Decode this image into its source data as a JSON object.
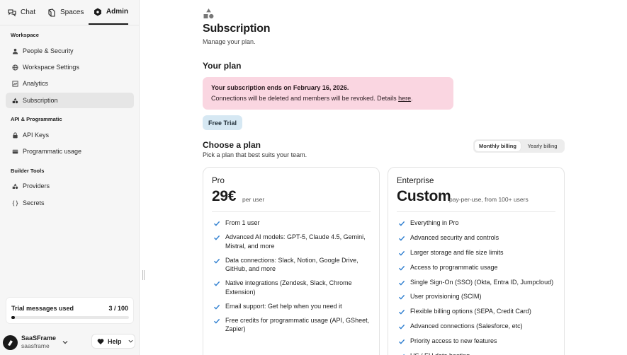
{
  "topnav": {
    "tabs": [
      {
        "label": "Chat",
        "icon": "chat-bubbles-icon"
      },
      {
        "label": "Spaces",
        "icon": "book-icon"
      },
      {
        "label": "Admin",
        "icon": "hexagon-gear-icon"
      }
    ],
    "active": "Admin"
  },
  "sidebar": {
    "sections": [
      {
        "title": "Workspace",
        "items": [
          {
            "label": "People & Security",
            "icon": "person-icon"
          },
          {
            "label": "Workspace Settings",
            "icon": "globe-icon"
          },
          {
            "label": "Analytics",
            "icon": "chart-icon"
          },
          {
            "label": "Subscription",
            "icon": "shapes-icon",
            "active": true
          }
        ]
      },
      {
        "title": "API & Programmatic",
        "items": [
          {
            "label": "API Keys",
            "icon": "lock-icon"
          },
          {
            "label": "Programmatic usage",
            "icon": "card-icon"
          }
        ]
      },
      {
        "title": "Builder Tools",
        "items": [
          {
            "label": "Providers",
            "icon": "shapes-icon"
          },
          {
            "label": "Secrets",
            "icon": "braces-icon"
          }
        ]
      }
    ],
    "trial": {
      "label": "Trial messages used",
      "count": "3 / 100",
      "used": 3,
      "total": 100
    },
    "account": {
      "name": "SaaSFrame",
      "sub": "saasframe"
    },
    "help_label": "Help"
  },
  "main": {
    "title": "Subscription",
    "subtitle": "Manage your plan.",
    "your_plan_heading": "Your plan",
    "alert": {
      "title": "Your subscription ends on February 16, 2026.",
      "body": "Connections will be deleted and members will be revoked. Details ",
      "link": "here",
      "period": "."
    },
    "current_plan_badge": "Free Trial",
    "choose_heading": "Choose a plan",
    "choose_sub": "Pick a plan that best suits your team.",
    "billing": {
      "monthly": "Monthly billing",
      "yearly": "Yearly billing",
      "selected": "monthly"
    },
    "plans": [
      {
        "name": "Pro",
        "price": "29€",
        "unit": "per user",
        "features": [
          "From 1 user",
          "Advanced AI models: GPT-5, Claude 4.5, Gemini, Mistral, and more",
          "Data connections: Slack, Notion, Google Drive, GitHub, and more",
          "Native integrations (Zendesk, Slack, Chrome Extension)",
          "Email support: Get help when you need it",
          "Free credits for programmatic usage (API, GSheet, Zapier)"
        ]
      },
      {
        "name": "Enterprise",
        "price": "Custom",
        "unit": "pay-per-use, from 100+ users",
        "features": [
          "Everything in Pro",
          "Advanced security and controls",
          "Larger storage and file size limits",
          "Access to programmatic usage",
          "Single Sign-On (SSO) (Okta, Entra ID, Jumpcloud)",
          "User provisioning (SCIM)",
          "Flexible billing options (SEPA, Credit Card)",
          "Advanced connections (Salesforce, etc)",
          "Priority access to new features",
          "US / EU data hosting"
        ]
      }
    ]
  },
  "colors": {
    "alert_bg": "#fad6e1",
    "badge_bg": "#d6e8f3",
    "check": "#2f7fd0",
    "sidebar_bg": "#f6f6f6"
  }
}
